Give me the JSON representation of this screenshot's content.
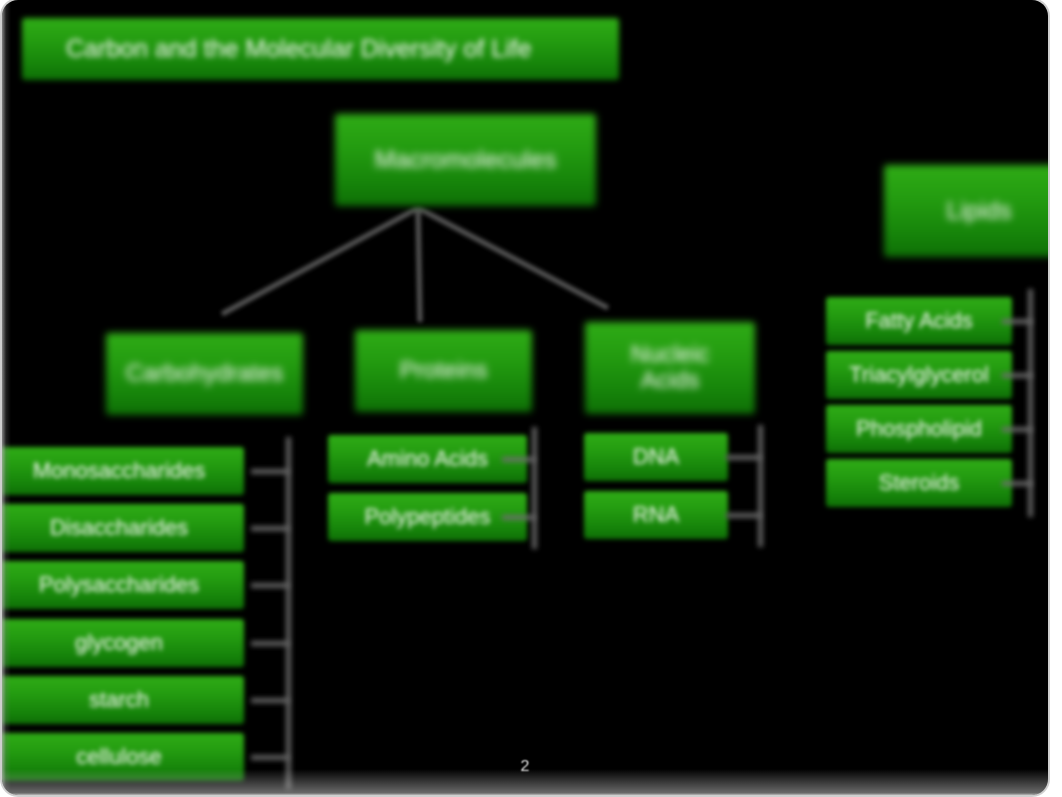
{
  "slide": {
    "title": "Carbon and the Molecular Diversity of Life",
    "page_number": "2",
    "background_color": "#000000",
    "node_color_top": "#2fac16",
    "node_color_bottom": "#0e6f06",
    "text_color": "#f2f6f0",
    "connector_color": "#6e6e6e"
  },
  "diagram": {
    "root": {
      "label": "Macromolecules"
    },
    "lipids_root": {
      "label": "Lipids"
    },
    "branches": [
      {
        "label": "Carbohydrates",
        "children": [
          {
            "label": "Monosaccharides"
          },
          {
            "label": "Disaccharides"
          },
          {
            "label": "Polysaccharides"
          },
          {
            "label": "glycogen"
          },
          {
            "label": "starch"
          },
          {
            "label": "cellulose"
          }
        ]
      },
      {
        "label": "Proteins",
        "children": [
          {
            "label": "Amino Acids"
          },
          {
            "label": "Polypeptides"
          }
        ]
      },
      {
        "label": "Nucleic\nAcids",
        "children": [
          {
            "label": "DNA"
          },
          {
            "label": "RNA"
          }
        ]
      },
      {
        "label": "Lipids",
        "children": [
          {
            "label": "Fatty Acids"
          },
          {
            "label": "Triacylglycerol"
          },
          {
            "label": "Phospholipid"
          },
          {
            "label": "Steroids"
          }
        ]
      }
    ]
  }
}
